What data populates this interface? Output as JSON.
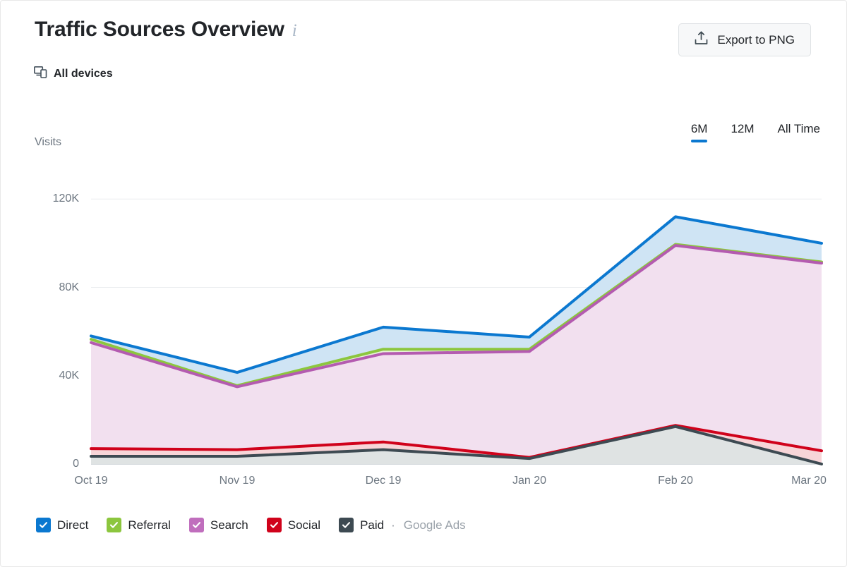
{
  "header": {
    "title": "Traffic Sources Overview",
    "info_icon": "info-icon",
    "devices_label": "All devices",
    "devices_icon": "devices-icon",
    "export_label": "Export to PNG",
    "export_icon": "export-upload-icon"
  },
  "range_tabs": [
    {
      "label": "6M",
      "active": true
    },
    {
      "label": "12M",
      "active": false
    },
    {
      "label": "All Time",
      "active": false
    }
  ],
  "chart_data": {
    "type": "area",
    "stacked": true,
    "title": "Traffic Sources Overview",
    "xlabel": "",
    "ylabel": "Visits",
    "ylim": [
      0,
      130000
    ],
    "yticks": [
      0,
      40000,
      80000,
      120000
    ],
    "ytick_labels": [
      "0",
      "40K",
      "80K",
      "120K"
    ],
    "grid": true,
    "legend_position": "bottom",
    "categories": [
      "Oct 19",
      "Nov 19",
      "Dec 19",
      "Jan 20",
      "Feb 20",
      "Mar 20"
    ],
    "series": [
      {
        "name": "Paid",
        "color": "#3d4a52",
        "fill": "#dfe3e3",
        "values": [
          3500,
          3500,
          6500,
          2500,
          17000,
          0
        ]
      },
      {
        "name": "Social",
        "color": "#d0021b",
        "fill": "#f7d5d8",
        "values": [
          7000,
          6500,
          10000,
          3000,
          17500,
          6000
        ]
      },
      {
        "name": "Search",
        "color": "#b45bb0",
        "fill": "#f2e0ef",
        "values": [
          55000,
          35000,
          50000,
          51000,
          99000,
          91000
        ]
      },
      {
        "name": "Referral",
        "color": "#8cc63e",
        "fill": "#e8f2d7",
        "values": [
          56500,
          35500,
          52000,
          52000,
          99500,
          91500
        ]
      },
      {
        "name": "Direct",
        "color": "#0b78d0",
        "fill": "#cfe4f4",
        "values": [
          58000,
          41500,
          62000,
          57500,
          112000,
          100000
        ]
      }
    ]
  },
  "legend": {
    "items": [
      {
        "label": "Direct",
        "color": "#0b78d0",
        "checked": true
      },
      {
        "label": "Referral",
        "color": "#8cc63e",
        "checked": true
      },
      {
        "label": "Search",
        "color": "#c06ebd",
        "checked": true
      },
      {
        "label": "Social",
        "color": "#d0021b",
        "checked": true
      },
      {
        "label": "Paid",
        "color": "#3d4a52",
        "checked": true
      }
    ],
    "separator": "·",
    "sublabel": "Google Ads"
  }
}
